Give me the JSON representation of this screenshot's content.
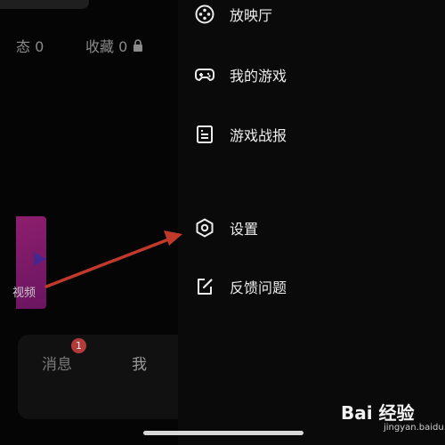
{
  "profile": {
    "stats": {
      "partial_label": "态 0",
      "favorites_label": "收藏 0"
    },
    "video_label": "视频",
    "bottom_nav": {
      "messages": "消息",
      "messages_badge": "1",
      "me": "我"
    }
  },
  "drawer": {
    "items": [
      {
        "label": "放映厅",
        "icon": "film-reel-icon"
      },
      {
        "label": "我的游戏",
        "icon": "gamepad-icon"
      },
      {
        "label": "游戏战报",
        "icon": "report-document-icon"
      },
      {
        "label": "设置",
        "icon": "hexagon-gear-icon"
      },
      {
        "label": "反馈问题",
        "icon": "edit-square-icon"
      }
    ]
  },
  "annotation": {
    "arrow_color": "#c0392b"
  },
  "watermark": {
    "brand": "Bai 经验",
    "url": "jingyan.baidu.com"
  },
  "colors": {
    "background": "#000000",
    "badge": "#b23a3a",
    "video_card": "#8d1e6e"
  }
}
